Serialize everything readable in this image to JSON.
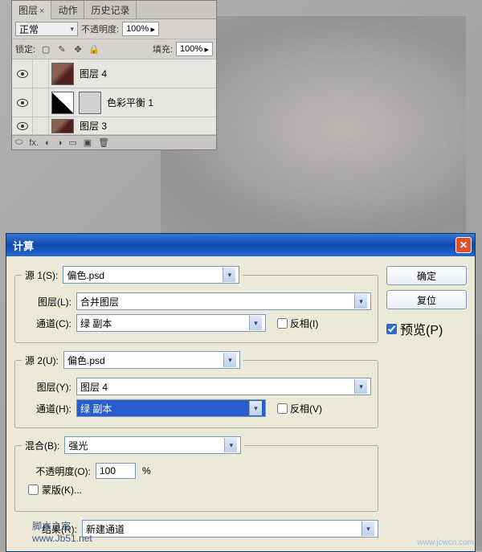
{
  "panel": {
    "tabs": {
      "layers": "图层",
      "actions": "动作",
      "history": "历史记录"
    },
    "blend_mode": "正常",
    "opacity_label": "不透明度:",
    "opacity_value": "100%",
    "lock_label": "锁定:",
    "fill_label": "填充:",
    "fill_value": "100%",
    "layers": [
      {
        "name": "图层 4"
      },
      {
        "name": "色彩平衡 1"
      },
      {
        "name": "图层 3"
      }
    ],
    "fx": "fx."
  },
  "dialog": {
    "title": "计算",
    "source1": {
      "legend": "源 1(S):",
      "file": "偏色.psd",
      "layer_label": "图层(L):",
      "layer_value": "合并图层",
      "channel_label": "通道(C):",
      "channel_value": "绿 副本",
      "invert": "反相(I)"
    },
    "source2": {
      "legend": "源 2(U):",
      "file": "偏色.psd",
      "layer_label": "图层(Y):",
      "layer_value": "图层 4",
      "channel_label": "通道(H):",
      "channel_value": "绿 副本",
      "invert": "反相(V)"
    },
    "blend": {
      "label": "混合(B):",
      "value": "强光"
    },
    "opacity": {
      "label": "不透明度(O):",
      "value": "100",
      "pct": "%"
    },
    "mask": "蒙版(K)...",
    "result": {
      "label": "结果(R):",
      "value": "新建通道"
    },
    "ok": "确定",
    "reset": "复位",
    "preview": "预览(P)"
  },
  "footer_site": "脚本之家",
  "footer_url": "www.Jb51.net",
  "watermark": "www.jcwcn.com"
}
